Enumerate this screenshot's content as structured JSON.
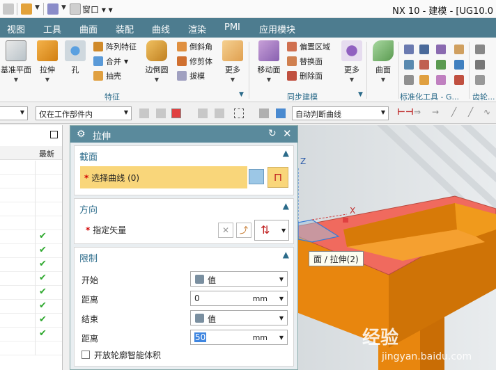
{
  "window": {
    "title": "NX 10 - 建模 - [UG10.0",
    "window_menu": "窗口"
  },
  "menubar": {
    "items": [
      "视图",
      "工具",
      "曲面",
      "装配",
      "曲线",
      "渲染",
      "PMI",
      "应用模块"
    ]
  },
  "ribbon": {
    "datum_plane": "基准平面",
    "extrude": "拉伸",
    "hole": "孔",
    "pattern_feature": "阵列特征",
    "unite": "合并",
    "shell": "抽壳",
    "edge_blend": "边倒圆",
    "chamfer": "倒斜角",
    "trim_body": "修剪体",
    "draft": "拔模",
    "more": "更多",
    "move_face": "移动面",
    "offset_region": "偏置区域",
    "replace_face": "替换面",
    "delete_face": "删除面",
    "surface": "曲面",
    "group_feature": "特征",
    "group_sync": "同步建模",
    "group_std": "标准化工具 - G...",
    "group_gear": "齿轮..."
  },
  "filterbar": {
    "scope": "仅在工作部件内",
    "curve_rule": "自动判断曲线"
  },
  "navigator": {
    "column_latest": "最新",
    "checked_rows": 8
  },
  "dialog": {
    "title": "拉伸",
    "section": {
      "title": "截面",
      "select_curve": "选择曲线 (0)"
    },
    "direction": {
      "title": "方向",
      "specify_vector": "指定矢量"
    },
    "limits": {
      "title": "限制",
      "start_label": "开始",
      "start_value": "值",
      "distance_label": "距离",
      "start_distance": "0",
      "unit": "mm",
      "end_label": "结束",
      "end_value": "值",
      "end_distance": "50",
      "open_profile": "开放轮廓智能体积"
    }
  },
  "viewport": {
    "axis_z": "Z",
    "axis_x": "X",
    "tooltip": "面 / 拉伸(2)",
    "watermark": "经验",
    "watermark_url": "jingyan.baidu.com",
    "colors": {
      "top_face": "#f06a5e",
      "side_face": "#e8860e",
      "side_dark": "#c96d05"
    }
  }
}
